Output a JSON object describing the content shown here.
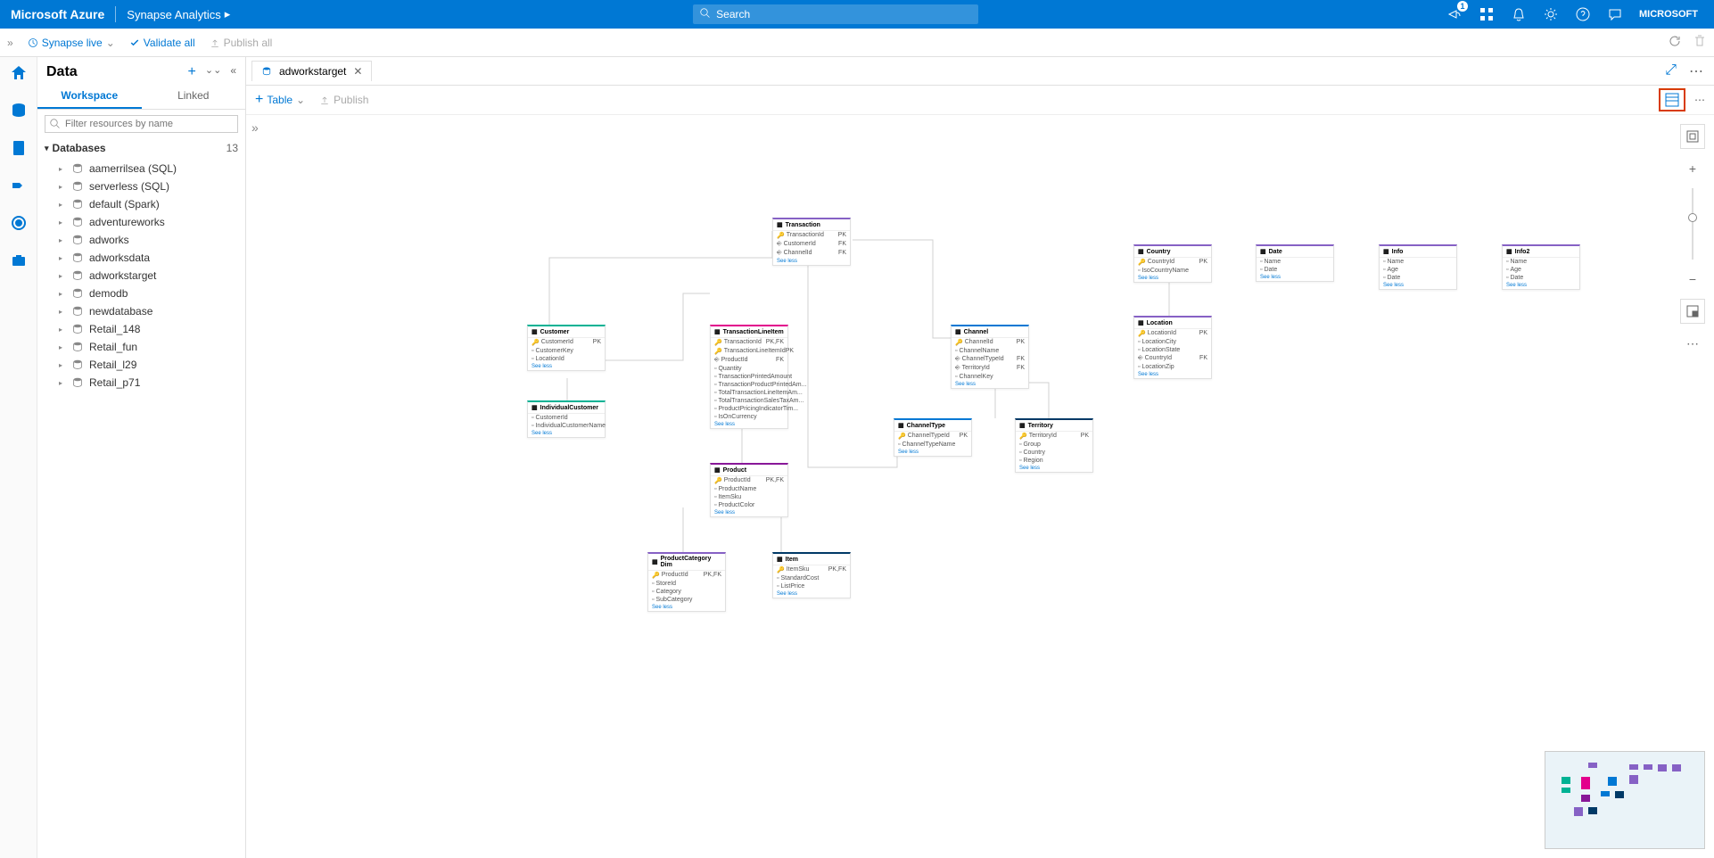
{
  "header": {
    "brand": "Microsoft Azure",
    "service": "Synapse Analytics",
    "search_placeholder": "Search",
    "account": "MICROSOFT",
    "notif_count": "1"
  },
  "toolbar": {
    "workspace": "Synapse live",
    "validate": "Validate all",
    "publish": "Publish all"
  },
  "datapanel": {
    "title": "Data",
    "tab_workspace": "Workspace",
    "tab_linked": "Linked",
    "filter_placeholder": "Filter resources by name",
    "section_label": "Databases",
    "section_count": "13",
    "items": [
      {
        "label": "aamerrilsea (SQL)"
      },
      {
        "label": "serverless (SQL)"
      },
      {
        "label": "default (Spark)"
      },
      {
        "label": "adventureworks"
      },
      {
        "label": "adworks"
      },
      {
        "label": "adworksdata"
      },
      {
        "label": "adworkstarget"
      },
      {
        "label": "demodb"
      },
      {
        "label": "newdatabase"
      },
      {
        "label": "Retail_148"
      },
      {
        "label": "Retail_fun"
      },
      {
        "label": "Retail_l29"
      },
      {
        "label": "Retail_p71"
      }
    ]
  },
  "tabs": {
    "open_tab": "adworkstarget"
  },
  "actions": {
    "table": "Table",
    "publish": "Publish"
  },
  "entities": {
    "transaction": {
      "title": "Transaction",
      "rows": [
        [
          "TransactionId",
          "PK"
        ],
        [
          "CustomerId",
          "FK"
        ],
        [
          "ChannelId",
          "FK"
        ]
      ],
      "link": "See less"
    },
    "customer": {
      "title": "Customer",
      "rows": [
        [
          "CustomerId",
          "PK"
        ],
        [
          "CustomerKey",
          ""
        ],
        [
          "LocationId",
          ""
        ]
      ],
      "link": "See less"
    },
    "individualcustomer": {
      "title": "IndividualCustomer",
      "rows": [
        [
          "CustomerId",
          ""
        ],
        [
          "IndividualCustomerName",
          ""
        ]
      ],
      "link": "See less"
    },
    "transactionlineitem": {
      "title": "TransactionLineItem",
      "rows": [
        [
          "TransactionId",
          "PK,FK"
        ],
        [
          "TransactionLineItemId",
          "PK"
        ],
        [
          "ProductId",
          "FK"
        ],
        [
          "Quantity",
          ""
        ],
        [
          "TransactionPrintedAmount",
          ""
        ],
        [
          "TransactionProductPrintedAm...",
          ""
        ],
        [
          "TotalTransactionLineItemAm...",
          ""
        ],
        [
          "TotalTransactionSalesTaxAm...",
          ""
        ],
        [
          "ProductPricingIndicatorTim...",
          ""
        ],
        [
          "IsOnCurrency",
          ""
        ]
      ],
      "link": "See less"
    },
    "channel": {
      "title": "Channel",
      "rows": [
        [
          "ChannelId",
          "PK"
        ],
        [
          "ChannelName",
          ""
        ],
        [
          "ChannelTypeId",
          "FK"
        ],
        [
          "TerritoryId",
          "FK"
        ],
        [
          "ChannelKey",
          ""
        ]
      ],
      "link": "See less"
    },
    "channeltype": {
      "title": "ChannelType",
      "rows": [
        [
          "ChannelTypeId",
          "PK"
        ],
        [
          "ChannelTypeName",
          ""
        ]
      ],
      "link": "See less"
    },
    "territory": {
      "title": "Territory",
      "rows": [
        [
          "TerritoryId",
          "PK"
        ],
        [
          "Group",
          ""
        ],
        [
          "Country",
          ""
        ],
        [
          "Region",
          ""
        ]
      ],
      "link": "See less"
    },
    "product": {
      "title": "Product",
      "rows": [
        [
          "ProductId",
          "PK,FK"
        ],
        [
          "ProductName",
          ""
        ],
        [
          "ItemSku",
          ""
        ],
        [
          "ProductColor",
          ""
        ]
      ],
      "link": "See less"
    },
    "productcategorydim": {
      "title": "ProductCategory Dim",
      "rows": [
        [
          "ProductId",
          "PK,FK"
        ],
        [
          "StoreId",
          ""
        ],
        [
          "Category",
          ""
        ],
        [
          "SubCategory",
          ""
        ]
      ],
      "link": "See less"
    },
    "item": {
      "title": "Item",
      "rows": [
        [
          "ItemSku",
          "PK,FK"
        ],
        [
          "StandardCost",
          ""
        ],
        [
          "ListPrice",
          ""
        ]
      ],
      "link": "See less"
    },
    "country": {
      "title": "Country",
      "rows": [
        [
          "CountryId",
          "PK"
        ],
        [
          "IsoCountryName",
          ""
        ]
      ],
      "link": "See less"
    },
    "location": {
      "title": "Location",
      "rows": [
        [
          "LocationId",
          "PK"
        ],
        [
          "LocationCity",
          ""
        ],
        [
          "LocationState",
          ""
        ],
        [
          "CountryId",
          "FK"
        ],
        [
          "LocationZip",
          ""
        ]
      ],
      "link": "See less"
    },
    "date": {
      "title": "Date",
      "rows": [
        [
          "Name",
          ""
        ],
        [
          "Date",
          ""
        ]
      ],
      "link": "See less"
    },
    "info": {
      "title": "Info",
      "rows": [
        [
          "Name",
          ""
        ],
        [
          "Age",
          ""
        ],
        [
          "Date",
          ""
        ]
      ],
      "link": "See less"
    },
    "info2": {
      "title": "Info2",
      "rows": [
        [
          "Name",
          ""
        ],
        [
          "Age",
          ""
        ],
        [
          "Date",
          ""
        ]
      ],
      "link": "See less"
    }
  }
}
